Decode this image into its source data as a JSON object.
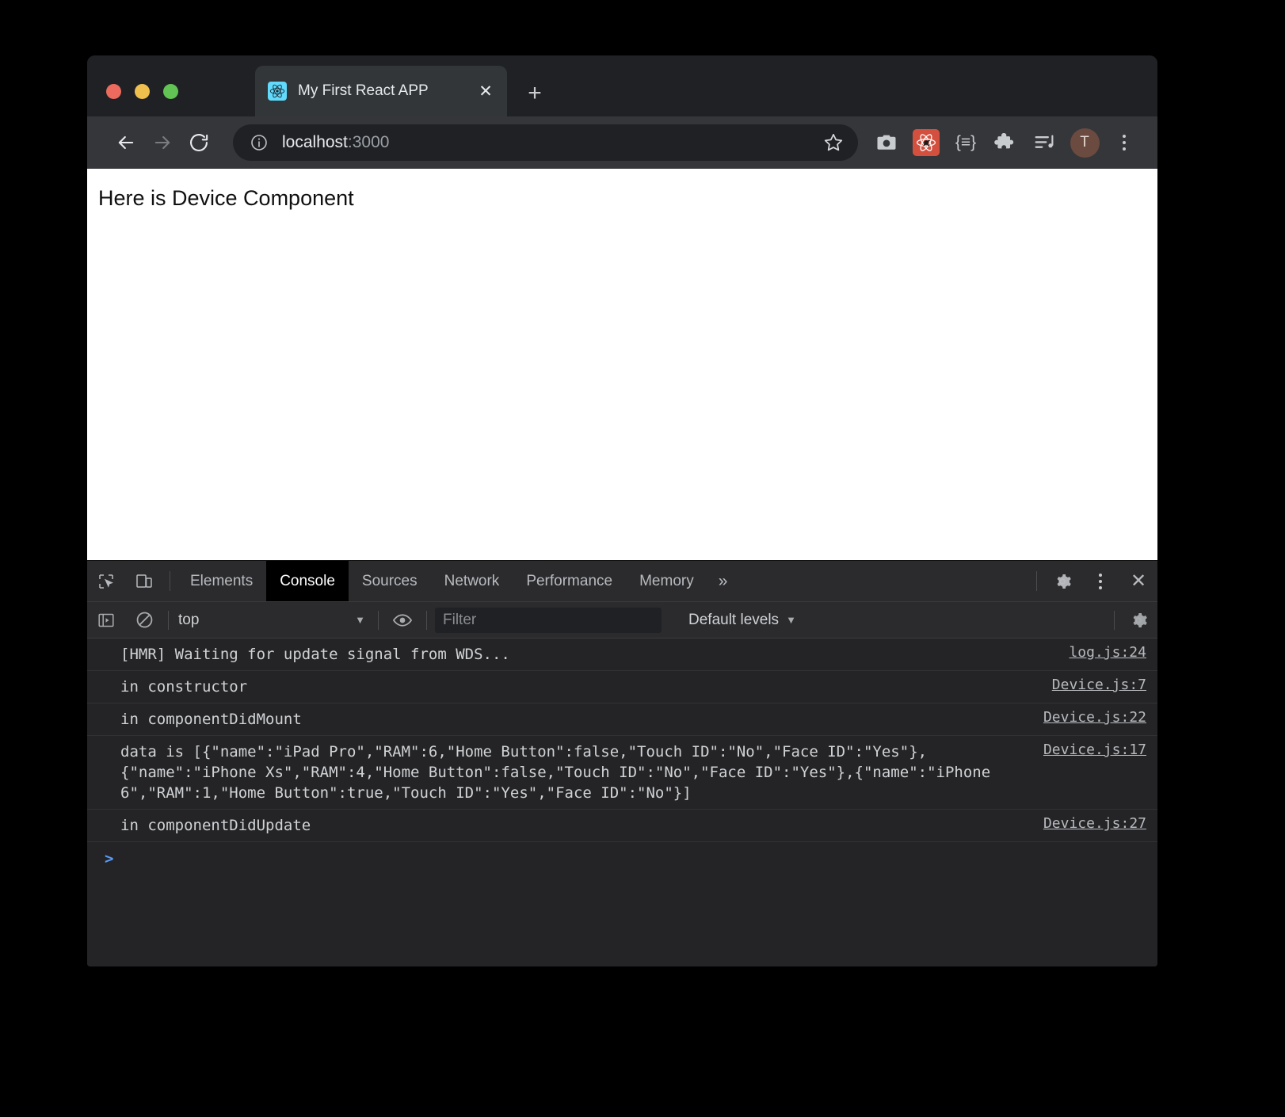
{
  "window": {
    "traffic_lights": [
      "close",
      "minimize",
      "zoom"
    ]
  },
  "tab": {
    "title": "My First React APP",
    "favicon": "react-logo-icon",
    "close_label": "✕",
    "new_tab_label": "+"
  },
  "nav": {
    "back_label": "←",
    "forward_label": "→",
    "reload_label": "⟳"
  },
  "omnibox": {
    "info_label": "ⓘ",
    "url_host": "localhost",
    "url_port": ":3000",
    "bookmark_label": "☆"
  },
  "extensions": [
    {
      "name": "screenshot-camera-icon",
      "label": ""
    },
    {
      "name": "react-devtools-icon",
      "label": ""
    },
    {
      "name": "json-formatter-icon",
      "label": "{≡}"
    },
    {
      "name": "puzzle-extensions-icon",
      "label": ""
    },
    {
      "name": "media-playlist-icon",
      "label": ""
    }
  ],
  "profile": {
    "initial": "T"
  },
  "page": {
    "heading": "Here is Device Component"
  },
  "devtools": {
    "inspect_icon": "inspect-element-icon",
    "device_icon": "device-toolbar-icon",
    "tabs": [
      {
        "label": "Elements",
        "active": false
      },
      {
        "label": "Console",
        "active": true
      },
      {
        "label": "Sources",
        "active": false
      },
      {
        "label": "Network",
        "active": false
      },
      {
        "label": "Performance",
        "active": false
      },
      {
        "label": "Memory",
        "active": false
      }
    ],
    "more_tabs_label": "»",
    "settings_label": "gear-icon",
    "kebab_label": "more-options-icon",
    "close_label": "✕"
  },
  "console_toolbar": {
    "sidebar_toggle": "console-sidebar-icon",
    "clear_label": "clear-console-icon",
    "context": "top",
    "context_caret": "▼",
    "eye_label": "live-expressions-icon",
    "filter_placeholder": "Filter",
    "levels_label": "Default levels",
    "levels_caret": "▼",
    "settings_label": "console-settings-icon"
  },
  "console_messages": [
    {
      "text": "[HMR] Waiting for update signal from WDS...",
      "source": "log.js:24"
    },
    {
      "text": "in constructor",
      "source": "Device.js:7"
    },
    {
      "text": "in componentDidMount",
      "source": "Device.js:22"
    },
    {
      "text": "data is [{\"name\":\"iPad Pro\",\"RAM\":6,\"Home Button\":false,\"Touch ID\":\"No\",\"Face ID\":\"Yes\"},{\"name\":\"iPhone Xs\",\"RAM\":4,\"Home Button\":false,\"Touch ID\":\"No\",\"Face ID\":\"Yes\"},{\"name\":\"iPhone 6\",\"RAM\":1,\"Home Button\":true,\"Touch ID\":\"Yes\",\"Face ID\":\"No\"}]",
      "source": "Device.js:17"
    },
    {
      "text": "in componentDidUpdate",
      "source": "Device.js:27"
    }
  ],
  "console_prompt": {
    "caret": ">",
    "value": ""
  },
  "colors": {
    "accent_blue": "#5a9cf8",
    "react_blue": "#61dafb",
    "react_ext_red": "#d3503f",
    "tab_active_bg": "#000000"
  }
}
